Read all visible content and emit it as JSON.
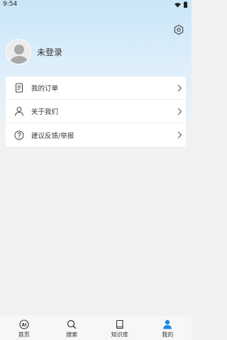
{
  "status": {
    "time": "9:54"
  },
  "profile": {
    "login_text": "未登录"
  },
  "menu": [
    {
      "label": "我的订单",
      "icon": "document-icon"
    },
    {
      "label": "关于我们",
      "icon": "person-icon"
    },
    {
      "label": "建议反馈/举报",
      "icon": "help-icon"
    }
  ],
  "tabs": [
    {
      "label": "首页",
      "icon": "ai-icon"
    },
    {
      "label": "搜索",
      "icon": "search-icon"
    },
    {
      "label": "知识库",
      "icon": "book-icon"
    },
    {
      "label": "我的",
      "icon": "user-icon",
      "active": true
    }
  ],
  "colors": {
    "accent": "#1e88e5",
    "gradient_top": "#c9e6f8",
    "background": "#f2f2f2"
  }
}
